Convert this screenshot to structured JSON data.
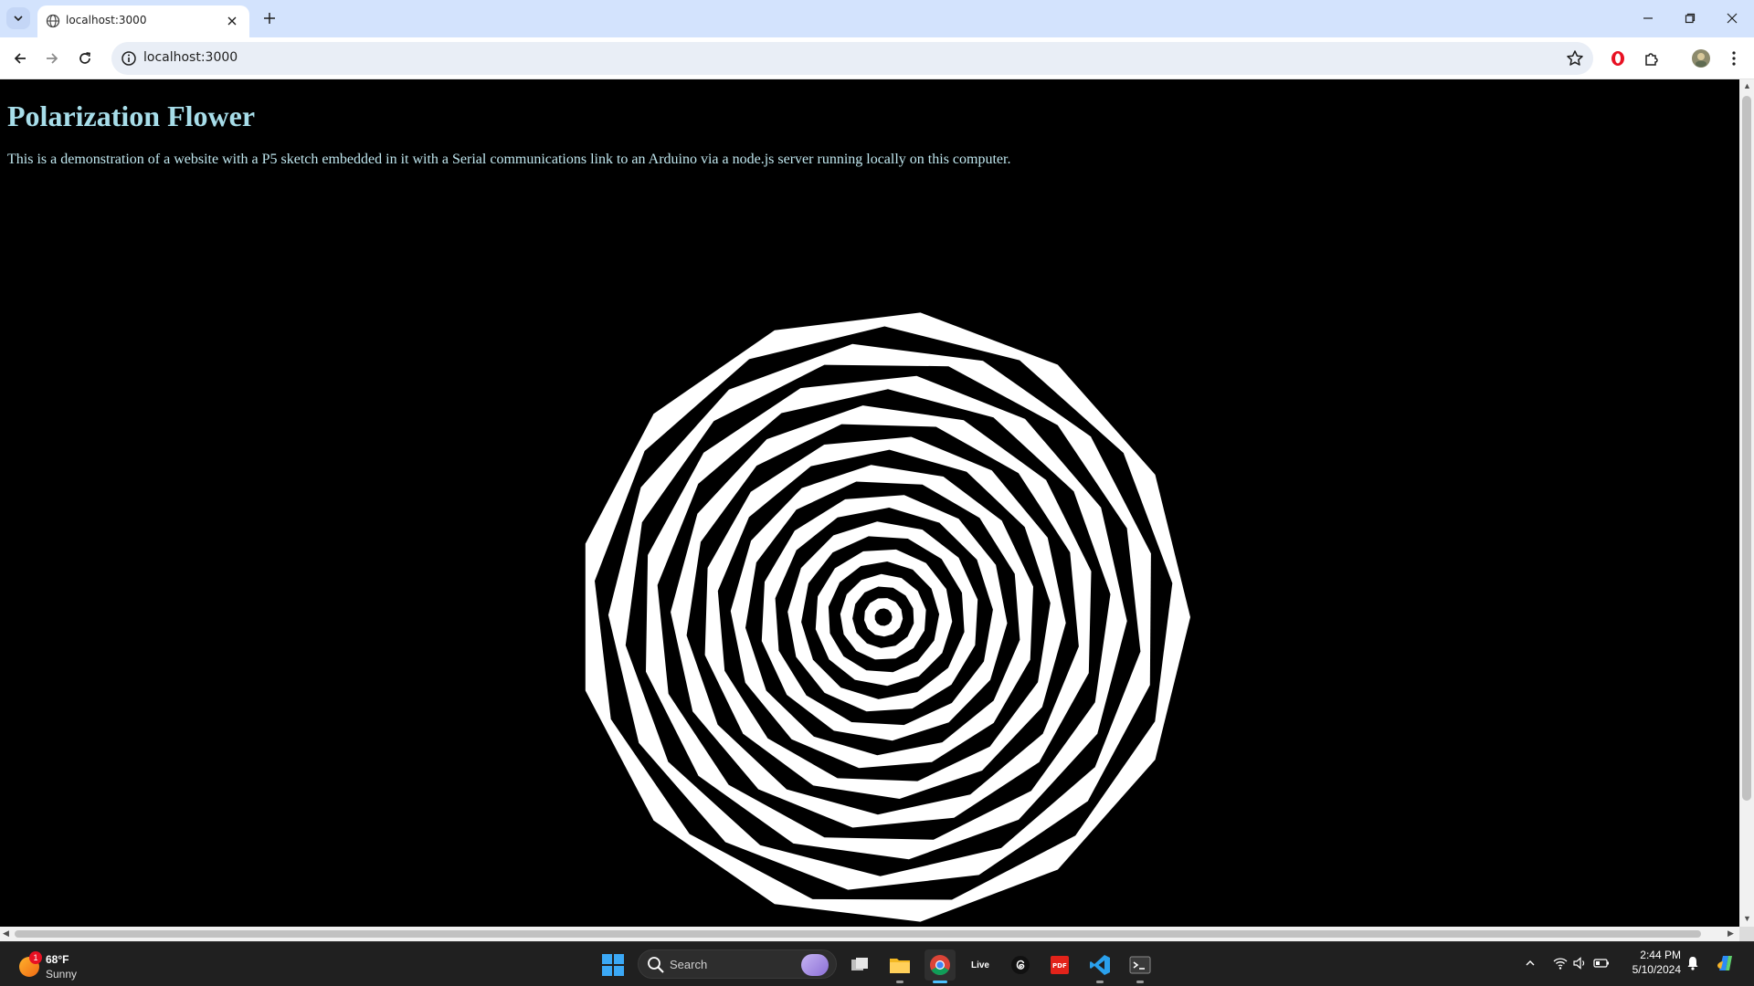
{
  "browser": {
    "tab_title": "localhost:3000",
    "url": "localhost:3000"
  },
  "page": {
    "heading": "Polarization Flower",
    "description": "This is a demonstration of a website with a P5 sketch embedded in it with a Serial communications link to an Arduino via a node.js server running locally on this computer."
  },
  "sketch": {
    "rings": 22,
    "sides": 13,
    "twist_deg": 21,
    "colors": {
      "fill": "#ffffff",
      "background": "#000000"
    }
  },
  "taskbar": {
    "weather_temp": "68°F",
    "weather_cond": "Sunny",
    "weather_badge": "1",
    "search_placeholder": "Search",
    "time": "2:44 PM",
    "date": "5/10/2024",
    "live_label": "Live"
  },
  "colors": {
    "heading": "#a7dde9",
    "tabbar": "#d3e3fd",
    "taskbar": "#202020"
  }
}
